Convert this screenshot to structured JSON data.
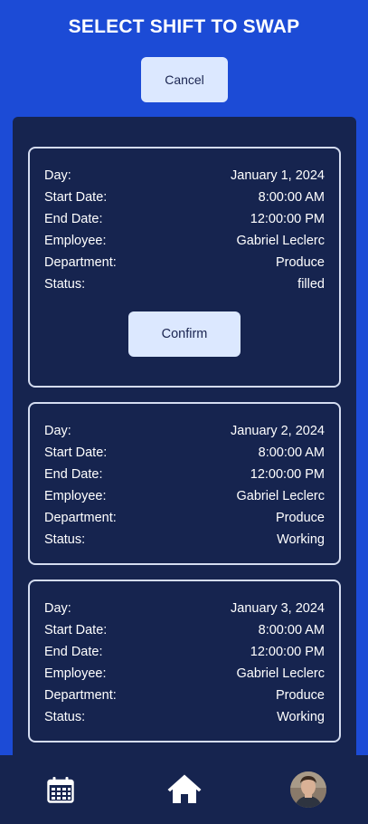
{
  "header": {
    "title": "SELECT SHIFT TO SWAP",
    "cancel_label": "Cancel"
  },
  "labels": {
    "day": "Day:",
    "start": "Start Date:",
    "end": "End Date:",
    "employee": "Employee:",
    "department": "Department:",
    "status": "Status:"
  },
  "shifts": [
    {
      "day": "January 1, 2024",
      "start": "8:00:00 AM",
      "end": "12:00:00 PM",
      "employee": "Gabriel Leclerc",
      "department": "Produce",
      "status": "filled",
      "confirm_label": "Confirm"
    },
    {
      "day": "January 2, 2024",
      "start": "8:00:00 AM",
      "end": "12:00:00 PM",
      "employee": "Gabriel Leclerc",
      "department": "Produce",
      "status": "Working"
    },
    {
      "day": "January 3, 2024",
      "start": "8:00:00 AM",
      "end": "12:00:00 PM",
      "employee": "Gabriel Leclerc",
      "department": "Produce",
      "status": "Working"
    }
  ],
  "nav": {
    "items": [
      {
        "icon": "calendar-icon"
      },
      {
        "icon": "home-icon"
      },
      {
        "icon": "avatar"
      }
    ]
  },
  "colors": {
    "background": "#1c4bd6",
    "panel": "#16244f",
    "button": "#dce8ff",
    "card_border": "#d4dcf0"
  }
}
